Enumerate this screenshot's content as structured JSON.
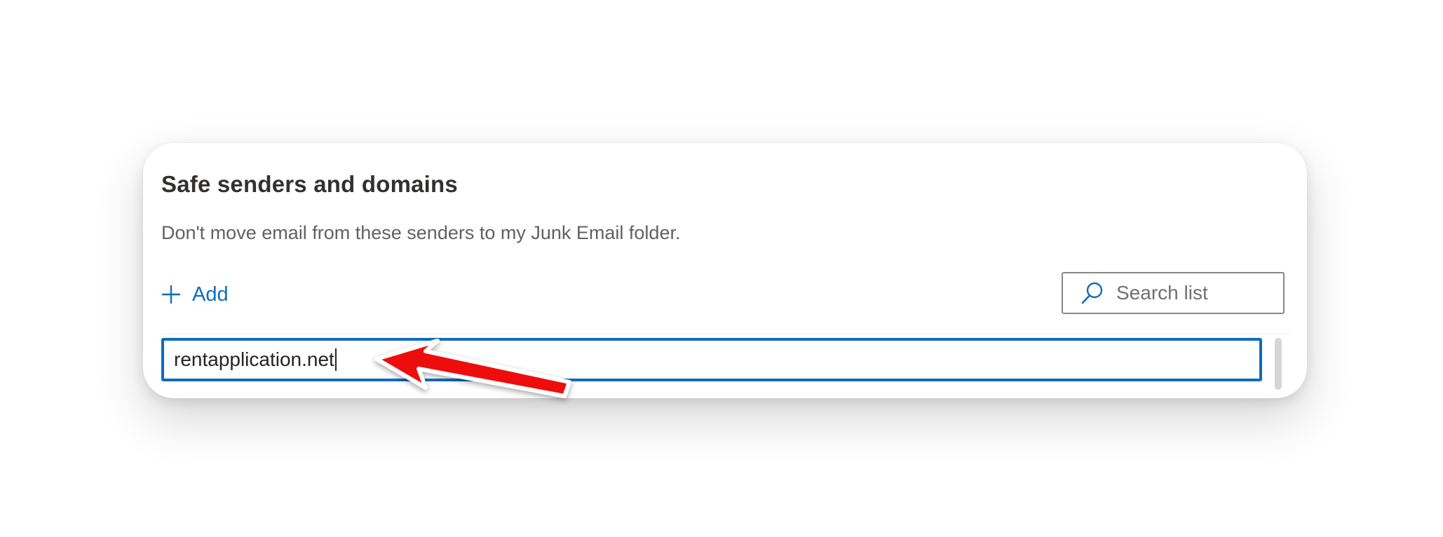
{
  "dialog": {
    "title": "Safe senders and domains",
    "description": "Don't move email from these senders to my Junk Email folder."
  },
  "toolbar": {
    "add_label": "Add",
    "add_icon": "plus-icon",
    "search_placeholder": "Search list",
    "search_icon": "search-icon"
  },
  "entry": {
    "value": "rentapplication.net"
  },
  "colors": {
    "accent": "#0f6cbd",
    "annotation_arrow": "#ee1111"
  }
}
